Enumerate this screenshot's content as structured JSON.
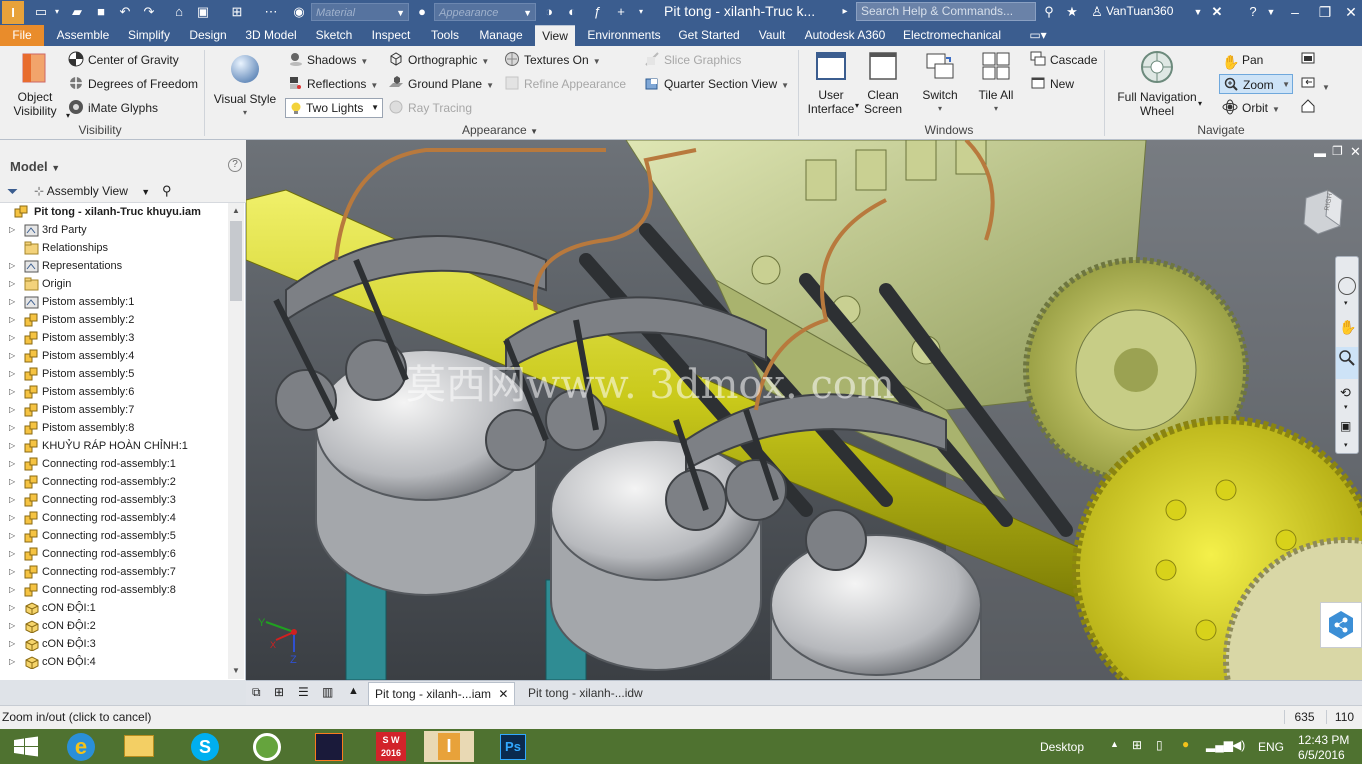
{
  "titlebar": {
    "app_badge": "I",
    "material_placeholder": "Material",
    "appearance_placeholder": "Appearance",
    "document_title": "Pit tong - xilanh-Truc k...",
    "search_placeholder": "Search Help & Commands...",
    "user_name": "VanTuan360"
  },
  "ribbon_tabs": [
    "File",
    "Assemble",
    "Simplify",
    "Design",
    "3D Model",
    "Sketch",
    "Inspect",
    "Tools",
    "Manage",
    "View",
    "Environments",
    "Get Started",
    "Vault",
    "Autodesk A360",
    "Electromechanical"
  ],
  "ribbon": {
    "visibility": {
      "object_visibility_line1": "Object",
      "object_visibility_line2": "Visibility",
      "center_of_gravity": "Center of Gravity",
      "degrees_of_freedom": "Degrees of Freedom",
      "imate_glyphs": "iMate Glyphs",
      "group_label": "Visibility"
    },
    "appearance": {
      "visual_style": "Visual Style",
      "shadows": "Shadows",
      "reflections": "Reflections",
      "lighting_value": "Two Lights",
      "orthographic": "Orthographic",
      "ground_plane": "Ground Plane",
      "ray_tracing": "Ray Tracing",
      "textures_on": "Textures On",
      "refine_appearance": "Refine Appearance",
      "slice_graphics": "Slice Graphics",
      "quarter_section_view": "Quarter Section View",
      "group_label": "Appearance"
    },
    "windows": {
      "user_interface_line1": "User",
      "user_interface_line2": "Interface",
      "clean_screen_line1": "Clean",
      "clean_screen_line2": "Screen",
      "switch": "Switch",
      "tile_all": "Tile All",
      "cascade": "Cascade",
      "new": "New",
      "group_label": "Windows"
    },
    "navigate": {
      "full_nav_wheel_line1": "Full Navigation",
      "full_nav_wheel_line2": "Wheel",
      "pan": "Pan",
      "zoom": "Zoom",
      "orbit": "Orbit",
      "group_label": "Navigate"
    }
  },
  "browser": {
    "title": "Model",
    "view_mode": "Assembly View",
    "root": "Pit tong - xilanh-Truc khuyu.iam",
    "items": [
      {
        "label": "3rd Party",
        "kind": "special"
      },
      {
        "label": "Relationships",
        "kind": "folder"
      },
      {
        "label": "Representations",
        "kind": "special"
      },
      {
        "label": "Origin",
        "kind": "folder"
      },
      {
        "label": "Pistom assembly:1",
        "kind": "special"
      },
      {
        "label": "Pistom assembly:2",
        "kind": "asm"
      },
      {
        "label": "Pistom assembly:3",
        "kind": "asm"
      },
      {
        "label": "Pistom assembly:4",
        "kind": "asm"
      },
      {
        "label": "Pistom assembly:5",
        "kind": "asm"
      },
      {
        "label": "Pistom assembly:6",
        "kind": "asm"
      },
      {
        "label": "Pistom assembly:7",
        "kind": "asm"
      },
      {
        "label": "Pistom assembly:8",
        "kind": "asm"
      },
      {
        "label": "KHUỶU RÁP HOÀN CHỈNH:1",
        "kind": "asm"
      },
      {
        "label": "Connecting rod-assembly:1",
        "kind": "asm"
      },
      {
        "label": "Connecting rod-assembly:2",
        "kind": "asm"
      },
      {
        "label": "Connecting rod-assembly:3",
        "kind": "asm"
      },
      {
        "label": "Connecting rod-assembly:4",
        "kind": "asm"
      },
      {
        "label": "Connecting rod-assembly:5",
        "kind": "asm"
      },
      {
        "label": "Connecting rod-assembly:6",
        "kind": "asm"
      },
      {
        "label": "Connecting rod-assembly:7",
        "kind": "asm"
      },
      {
        "label": "Connecting rod-assembly:8",
        "kind": "asm"
      },
      {
        "label": "cON ĐỘI:1",
        "kind": "part"
      },
      {
        "label": "cON ĐỘI:2",
        "kind": "part"
      },
      {
        "label": "cON ĐỘI:3",
        "kind": "part"
      },
      {
        "label": "cON ĐỘI:4",
        "kind": "part"
      }
    ]
  },
  "viewport": {
    "watermark": "莫西网www. 3dmox. com",
    "viewcube_face": "RIGHT",
    "triad_x": "X",
    "triad_y": "Y",
    "triad_z": "Z"
  },
  "doc_tabs": [
    {
      "label": "Pit tong - xilanh-...iam",
      "active": true
    },
    {
      "label": "Pit tong - xilanh-...idw",
      "active": false
    }
  ],
  "statusbar": {
    "message": "Zoom in/out (click to cancel)",
    "count_a": "635",
    "count_b": "110"
  },
  "taskbar": {
    "desktop_label": "Desktop",
    "language": "ENG",
    "time": "12:43 PM",
    "date": "6/5/2016",
    "sw_label": "2016"
  },
  "colors": {
    "titlebar": "#3b5d8f",
    "file_tab": "#e98c2b",
    "taskbar": "#4f7230",
    "zoom_highlight": "#cde3f7"
  }
}
